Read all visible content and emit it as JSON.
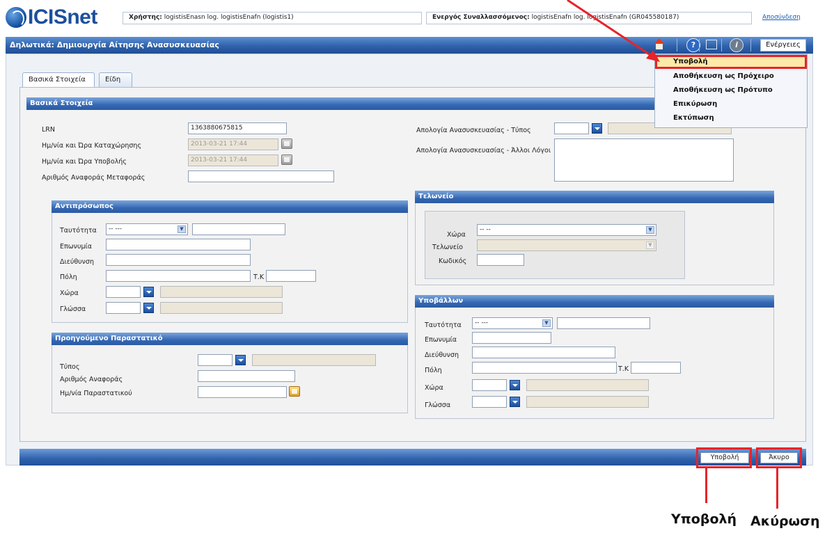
{
  "header": {
    "logo": "ICISnet",
    "user_label": "Χρήστης:",
    "user_value": "logistisEnasn log. logistisEnafn (logistis1)",
    "active_label": "Ενεργός Συναλλασσόμενος:",
    "active_value": "logistisEnafn log. logistisEnafn (GR045580187)",
    "logout": "Αποσύνδεση"
  },
  "titlebar": {
    "title": "Δηλωτικά: Δημιουργία Αίτησης Ανασυσκευασίας",
    "actions": "Ενέργειες"
  },
  "menu": {
    "items": [
      "Υποβολή",
      "Αποθήκευση ως Πρόχειρο",
      "Αποθήκευση ως Πρότυπο",
      "Επικύρωση",
      "Εκτύπωση"
    ]
  },
  "tabs": [
    "Βασικά Στοιχεία",
    "Είδη"
  ],
  "basic": {
    "header": "Βασικά Στοιχεία",
    "lrn_label": "LRN",
    "lrn_value": "1363880675815",
    "reg_date_label": "Ημ/νία και Ώρα Καταχώρησης",
    "reg_date_value": "2013-03-21 17:44",
    "sub_date_label": "Ημ/νία και Ώρα Υποβολής",
    "sub_date_value": "2013-03-21 17:44",
    "transport_ref_label": "Αριθμός Αναφοράς Μεταφοράς",
    "reason_type_label": "Απολογία Ανασυσκευασίας - Τύπος",
    "reason_other_label": "Απολογία Ανασυσκευασίας - Άλλοι Λόγοι"
  },
  "representative": {
    "header": "Αντιπρόσωπος",
    "identity_label": "Ταυτότητα",
    "identity_value": "-- ---",
    "surname_label": "Επωνυμία",
    "address_label": "Διεύθυνση",
    "city_label": "Πόλη",
    "postcode_label": "Τ.Κ",
    "country_label": "Χώρα",
    "language_label": "Γλώσσα"
  },
  "previous_doc": {
    "header": "Προηγούμενο Παραστατικό",
    "type_label": "Τύπος",
    "ref_label": "Αριθμός Αναφοράς",
    "date_label": "Ημ/νία Παραστατικού"
  },
  "customs": {
    "header": "Τελωνείο",
    "country_label": "Χώρα",
    "country_value": "-- --",
    "office_label": "Τελωνείο",
    "code_label": "Κωδικός"
  },
  "submitter": {
    "header": "Υποβάλλων",
    "identity_label": "Ταυτότητα",
    "identity_value": "-- ---",
    "surname_label": "Επωνυμία",
    "address_label": "Διεύθυνση",
    "city_label": "Πόλη",
    "postcode_label": "Τ.Κ",
    "country_label": "Χώρα",
    "language_label": "Γλώσσα"
  },
  "footer": {
    "submit": "Υποβολή",
    "cancel": "Άκυρο"
  },
  "annotations": {
    "submit": "Υποβολή",
    "cancel": "Ακύρωση"
  },
  "colors": {
    "annotation_red": "#e6242a",
    "header_blue": "#2f62ab"
  }
}
